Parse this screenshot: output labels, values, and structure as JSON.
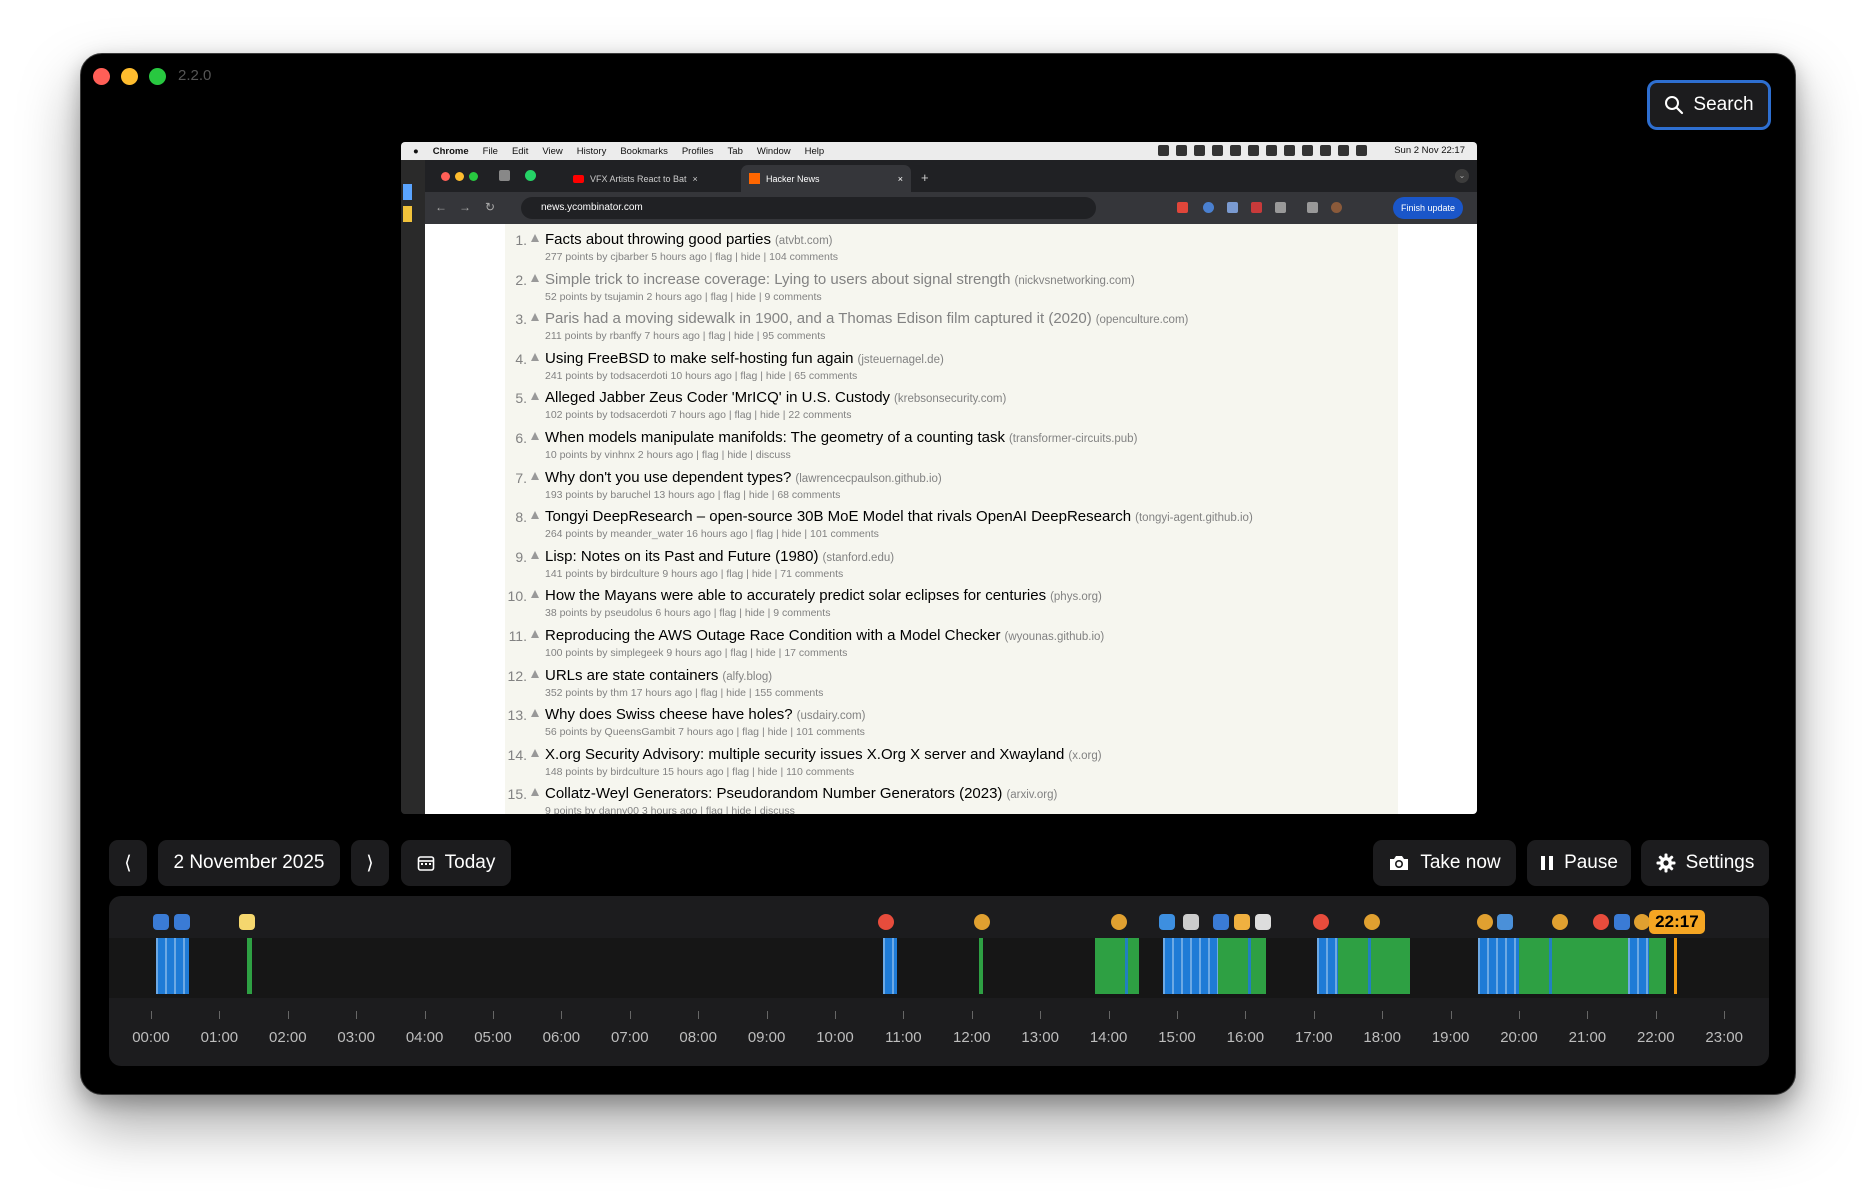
{
  "app": {
    "version": "2.2.0",
    "search_label": "Search"
  },
  "preview": {
    "menubar": {
      "apple": "",
      "app_name": "Chrome",
      "menus": [
        "File",
        "Edit",
        "View",
        "History",
        "Bookmarks",
        "Profiles",
        "Tab",
        "Window",
        "Help"
      ],
      "clock": "Sun 2 Nov  22:17"
    },
    "tabs": [
      {
        "title": "VFX Artists React to Bat",
        "icon": "youtube-icon"
      },
      {
        "title": "Hacker News",
        "icon": "hacker-news-icon"
      }
    ],
    "new_tab": "+",
    "url": "news.ycombinator.com",
    "update_label": "Finish update",
    "hn_items": [
      {
        "rank": "1.",
        "title": "Facts about throwing good parties",
        "site": "(atvbt.com)",
        "sub": "277 points by cjbarber 5 hours ago | flag | hide | 104 comments",
        "visited": false
      },
      {
        "rank": "2.",
        "title": "Simple trick to increase coverage: Lying to users about signal strength",
        "site": "(nickvsnetworking.com)",
        "sub": "52 points by tsujamin 2 hours ago | flag | hide | 9 comments",
        "visited": true
      },
      {
        "rank": "3.",
        "title": "Paris had a moving sidewalk in 1900, and a Thomas Edison film captured it (2020)",
        "site": "(openculture.com)",
        "sub": "211 points by rbanffy 7 hours ago | flag | hide | 95 comments",
        "visited": true
      },
      {
        "rank": "4.",
        "title": "Using FreeBSD to make self-hosting fun again",
        "site": "(jsteuernagel.de)",
        "sub": "241 points by todsacerdoti 10 hours ago | flag | hide | 65 comments",
        "visited": false
      },
      {
        "rank": "5.",
        "title": "Alleged Jabber Zeus Coder 'MrICQ' in U.S. Custody",
        "site": "(krebsonsecurity.com)",
        "sub": "102 points by todsacerdoti 7 hours ago | flag | hide | 22 comments",
        "visited": false
      },
      {
        "rank": "6.",
        "title": "When models manipulate manifolds: The geometry of a counting task",
        "site": "(transformer-circuits.pub)",
        "sub": "10 points by vinhnx 2 hours ago | flag | hide | discuss",
        "visited": false
      },
      {
        "rank": "7.",
        "title": "Why don't you use dependent types?",
        "site": "(lawrencecpaulson.github.io)",
        "sub": "193 points by baruchel 13 hours ago | flag | hide | 68 comments",
        "visited": false
      },
      {
        "rank": "8.",
        "title": "Tongyi DeepResearch – open-source 30B MoE Model that rivals OpenAI DeepResearch",
        "site": "(tongyi-agent.github.io)",
        "sub": "264 points by meander_water 16 hours ago | flag | hide | 101 comments",
        "visited": false
      },
      {
        "rank": "9.",
        "title": "Lisp: Notes on its Past and Future (1980)",
        "site": "(stanford.edu)",
        "sub": "141 points by birdculture 9 hours ago | flag | hide | 71 comments",
        "visited": false
      },
      {
        "rank": "10.",
        "title": "How the Mayans were able to accurately predict solar eclipses for centuries",
        "site": "(phys.org)",
        "sub": "38 points by pseudolus 6 hours ago | flag | hide | 9 comments",
        "visited": false
      },
      {
        "rank": "11.",
        "title": "Reproducing the AWS Outage Race Condition with a Model Checker",
        "site": "(wyounas.github.io)",
        "sub": "100 points by simplegeek 9 hours ago | flag | hide | 17 comments",
        "visited": false
      },
      {
        "rank": "12.",
        "title": "URLs are state containers",
        "site": "(alfy.blog)",
        "sub": "352 points by thm 17 hours ago | flag | hide | 155 comments",
        "visited": false
      },
      {
        "rank": "13.",
        "title": "Why does Swiss cheese have holes?",
        "site": "(usdairy.com)",
        "sub": "56 points by QueensGambit 7 hours ago | flag | hide | 101 comments",
        "visited": false
      },
      {
        "rank": "14.",
        "title": "X.org Security Advisory: multiple security issues X.Org X server and Xwayland",
        "site": "(x.org)",
        "sub": "148 points by birdculture 15 hours ago | flag | hide | 110 comments",
        "visited": false
      },
      {
        "rank": "15.",
        "title": "Collatz-Weyl Generators: Pseudorandom Number Generators (2023)",
        "site": "(arxiv.org)",
        "sub": "9 points by danny00 3 hours ago | flag | hide | discuss",
        "visited": false
      }
    ]
  },
  "controls": {
    "prev_day": "⟨",
    "date": "2 November 2025",
    "next_day": "⟩",
    "today": "Today",
    "take_now": "Take now",
    "pause": "Pause",
    "settings": "Settings"
  },
  "timeline": {
    "hours": [
      "00:00",
      "01:00",
      "02:00",
      "03:00",
      "04:00",
      "05:00",
      "06:00",
      "07:00",
      "08:00",
      "09:00",
      "10:00",
      "11:00",
      "12:00",
      "13:00",
      "14:00",
      "15:00",
      "16:00",
      "17:00",
      "18:00",
      "19:00",
      "20:00",
      "21:00",
      "22:00",
      "23:00"
    ],
    "current_time": "22:17",
    "activity_segments": [
      {
        "start": 0.08,
        "end": 0.55,
        "color": "#1f7bd6"
      },
      {
        "start": 1.4,
        "end": 1.48,
        "color": "#2ea043"
      },
      {
        "start": 10.7,
        "end": 10.9,
        "color": "#1f7bd6"
      },
      {
        "start": 12.1,
        "end": 12.17,
        "color": "#2ea043"
      },
      {
        "start": 13.8,
        "end": 14.45,
        "color": "#2ea043"
      },
      {
        "start": 14.8,
        "end": 15.6,
        "color": "#1f7bd6"
      },
      {
        "start": 15.6,
        "end": 16.3,
        "color": "#2ea043"
      },
      {
        "start": 17.05,
        "end": 17.35,
        "color": "#1f7bd6"
      },
      {
        "start": 17.35,
        "end": 18.4,
        "color": "#2ea043"
      },
      {
        "start": 19.4,
        "end": 20.0,
        "color": "#1f7bd6"
      },
      {
        "start": 20.0,
        "end": 21.6,
        "color": "#2ea043"
      },
      {
        "start": 21.6,
        "end": 21.9,
        "color": "#1f7bd6"
      },
      {
        "start": 21.9,
        "end": 22.15,
        "color": "#2ea043"
      }
    ],
    "app_icons": [
      {
        "hour": 0.15,
        "name": "xcode-icon",
        "color": "#3a7bd5"
      },
      {
        "hour": 0.45,
        "name": "xcode-icon",
        "color": "#3a7bd5"
      },
      {
        "hour": 1.4,
        "name": "notes-icon",
        "color": "#f5d76e"
      },
      {
        "hour": 10.75,
        "name": "record-icon",
        "color": "#e74c3c"
      },
      {
        "hour": 12.15,
        "name": "chrome-icon",
        "color": "#e0a030"
      },
      {
        "hour": 14.15,
        "name": "chrome-icon",
        "color": "#e0a030"
      },
      {
        "hour": 14.85,
        "name": "finder-icon",
        "color": "#3d8fe0"
      },
      {
        "hour": 15.2,
        "name": "preview-icon",
        "color": "#cccccc"
      },
      {
        "hour": 15.65,
        "name": "xcode-icon",
        "color": "#3a7bd5"
      },
      {
        "hour": 15.95,
        "name": "terminal-icon",
        "color": "#f0b040"
      },
      {
        "hour": 16.25,
        "name": "textedit-icon",
        "color": "#dddddd"
      },
      {
        "hour": 17.1,
        "name": "record-icon",
        "color": "#e74c3c"
      },
      {
        "hour": 17.85,
        "name": "chrome-icon",
        "color": "#e0a030"
      },
      {
        "hour": 19.5,
        "name": "chrome-icon",
        "color": "#e0a030"
      },
      {
        "hour": 19.8,
        "name": "dropbox-icon",
        "color": "#4a90d9"
      },
      {
        "hour": 20.6,
        "name": "chrome-icon",
        "color": "#e0a030"
      },
      {
        "hour": 21.2,
        "name": "record-icon",
        "color": "#e74c3c"
      },
      {
        "hour": 21.5,
        "name": "xcode-icon",
        "color": "#3a7bd5"
      },
      {
        "hour": 21.8,
        "name": "chrome-icon",
        "color": "#e0a030"
      }
    ]
  }
}
